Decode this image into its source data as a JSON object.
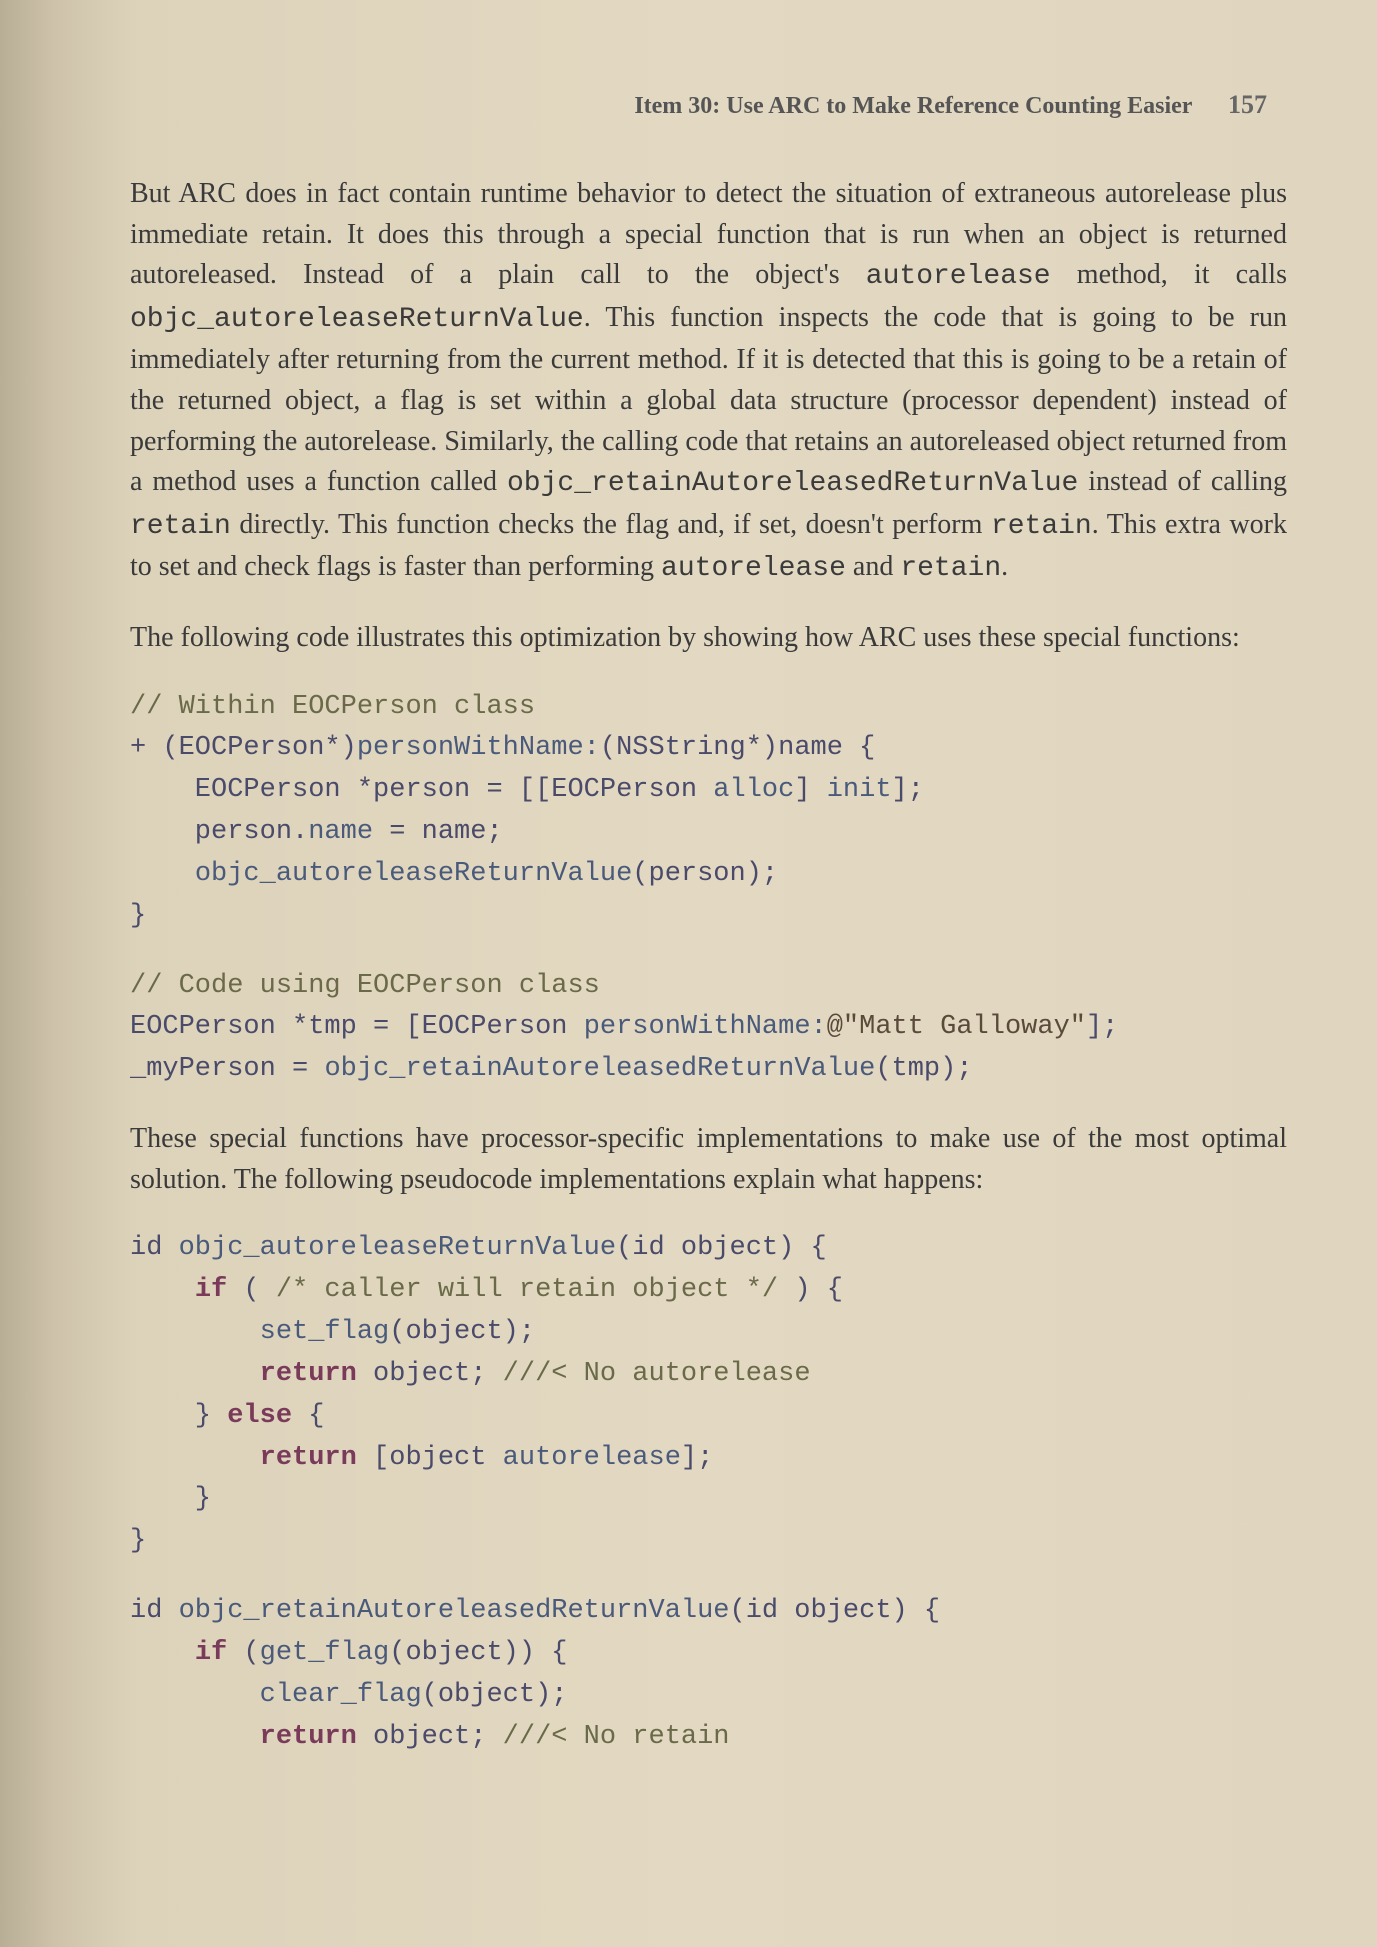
{
  "header": {
    "title": "Item 30: Use ARC to Make Reference Counting Easier",
    "page_number": "157"
  },
  "paragraphs": {
    "p1_part1": "But ARC does in fact contain runtime behavior to detect the situation of extraneous autorelease plus immediate retain. It does this through a special function that is run when an object is returned autoreleased. Instead of a plain call to the object's ",
    "p1_mono1": "autorelease",
    "p1_part2": " method, it calls ",
    "p1_mono2": "objc_autoreleaseReturnValue",
    "p1_part3": ". This function inspects the code that is going to be run immediately after returning from the current method. If it is detected that this is going to be a retain of the returned object, a flag is set within a global data structure (processor dependent) instead of performing the autorelease. Similarly, the calling code that retains an autoreleased object returned from a method uses a function called ",
    "p1_mono3": "objc_retainAutoreleasedReturnValue",
    "p1_part4": " instead of calling ",
    "p1_mono4": "retain",
    "p1_part5": " directly. This function checks the flag and, if set, doesn't perform ",
    "p1_mono5": "retain",
    "p1_part6": ". This extra work to set and check flags is faster than performing ",
    "p1_mono6": "autorelease",
    "p1_part7": " and ",
    "p1_mono7": "retain",
    "p1_part8": ".",
    "p2": "The following code illustrates this optimization by showing how ARC uses these special functions:",
    "p3": "These special functions have processor-specific implementations to make use of the most optimal solution. The following pseudocode implementations explain what happens:"
  },
  "code1": {
    "l1": "// Within EOCPerson class",
    "l2a": "+ (EOCPerson*)",
    "l2b": "personWithName:",
    "l2c": "(NSString*)name {",
    "l3a": "    EOCPerson *person = [[EOCPerson ",
    "l3b": "alloc",
    "l3c": "] ",
    "l3d": "init",
    "l3e": "];",
    "l4a": "    person.",
    "l4b": "name",
    "l4c": " = name;",
    "l5a": "    ",
    "l5b": "objc_autoreleaseReturnValue",
    "l5c": "(person);",
    "l6": "}"
  },
  "code2": {
    "l1": "// Code using EOCPerson class",
    "l2a": "EOCPerson *tmp = [EOCPerson ",
    "l2b": "personWithName:",
    "l2c": "@\"Matt Galloway\"",
    "l2d": "];",
    "l3a": "_myPerson = ",
    "l3b": "objc_retainAutoreleasedReturnValue",
    "l3c": "(tmp);"
  },
  "code3": {
    "l1a": "id ",
    "l1b": "objc_autoreleaseReturnValue",
    "l1c": "(id object) {",
    "l2a": "    ",
    "l2b": "if",
    "l2c": " ( ",
    "l2d": "/* caller will retain object */",
    "l2e": " ) {",
    "l3a": "        ",
    "l3b": "set_flag",
    "l3c": "(object);",
    "l4a": "        ",
    "l4b": "return",
    "l4c": " object; ",
    "l4d": "///< No autorelease",
    "l5a": "    } ",
    "l5b": "else",
    "l5c": " {",
    "l6a": "        ",
    "l6b": "return",
    "l6c": " [object ",
    "l6d": "autorelease",
    "l6e": "];",
    "l7": "    }",
    "l8": "}"
  },
  "code4": {
    "l1a": "id ",
    "l1b": "objc_retainAutoreleasedReturnValue",
    "l1c": "(id object) {",
    "l2a": "    ",
    "l2b": "if",
    "l2c": " (",
    "l2d": "get_flag",
    "l2e": "(object)) {",
    "l3a": "        ",
    "l3b": "clear_flag",
    "l3c": "(object);",
    "l4a": "        ",
    "l4b": "return",
    "l4c": " object; ",
    "l4d": "///< No retain"
  }
}
